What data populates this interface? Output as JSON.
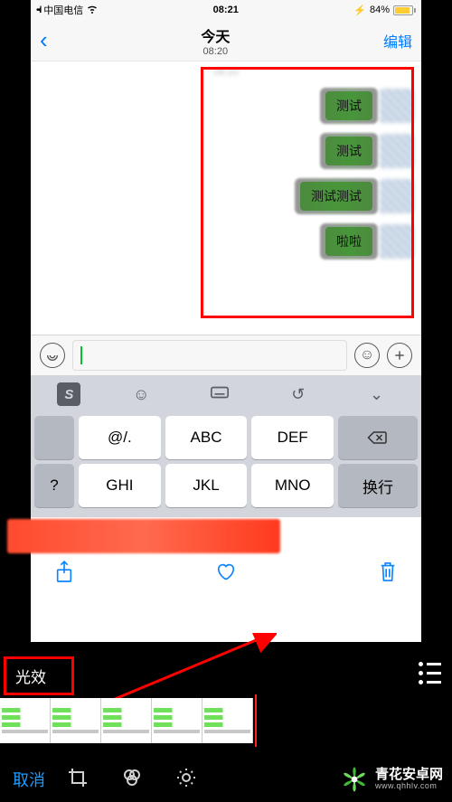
{
  "status": {
    "carrier": "中国电信",
    "time": "08:21",
    "battery_pct": "84%",
    "battery_icon": "⚡"
  },
  "nav": {
    "back_glyph": "‹",
    "title": "今天",
    "subtitle": "08:20",
    "edit": "编辑"
  },
  "chat": {
    "timestamp_blur": "08:20",
    "messages": [
      "测试",
      "测试",
      "测试测试",
      "啦啦"
    ]
  },
  "input_bar": {
    "voice_glyph": "))",
    "emoji_glyph": "☺",
    "plus_glyph": "+"
  },
  "kbd_toolbar": {
    "sogou": "S",
    "emoji": "☺",
    "ime": "⌨",
    "reset": "↺",
    "collapse": "⌄"
  },
  "keyboard": {
    "r1": [
      "@/.",
      "ABC",
      "DEF"
    ],
    "r1_backspace": "⌫",
    "r2_left": "?",
    "r2": [
      "GHI",
      "JKL",
      "MNO"
    ],
    "r2_enter": "换行"
  },
  "phone_bottom": {
    "share": "share",
    "heart": "heart",
    "trash": "trash"
  },
  "editor": {
    "fx_label": "光效",
    "cancel": "取消"
  },
  "watermark": {
    "line1": "青花安卓网",
    "line2": "www.qhhlv.com"
  }
}
